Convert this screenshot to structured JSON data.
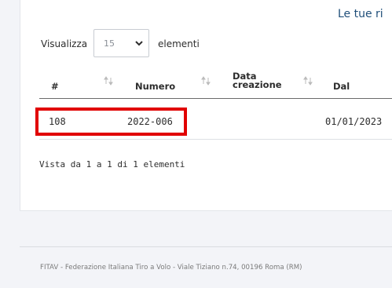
{
  "page": {
    "heading": "Le tue ri"
  },
  "length_control": {
    "prefix": "Visualizza",
    "selected": "15",
    "suffix": "elementi"
  },
  "table": {
    "columns": [
      {
        "label": "#"
      },
      {
        "label": "Numero"
      },
      {
        "label": "Data\ncreazione"
      },
      {
        "label": "Dal"
      }
    ],
    "rows": [
      {
        "id": "108",
        "numero": "2022-006",
        "data_creazione": "",
        "dal": "01/01/2023"
      }
    ],
    "info": "Vista da 1 a 1 di 1 elementi"
  },
  "footer": {
    "text": "FITAV - Federazione Italiana Tiro a Volo - Viale Tiziano n.74, 00196 Roma (RM)"
  },
  "colors": {
    "highlight": "#e10000",
    "heading": "#1f4e79",
    "background": "#f3f4f8"
  }
}
